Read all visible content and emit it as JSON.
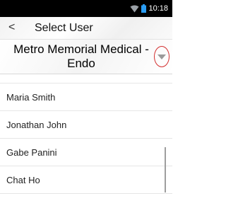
{
  "status_bar": {
    "time": "10:18",
    "icons": [
      "wifi-icon",
      "battery-icon"
    ],
    "battery_color": "#2a9df4"
  },
  "header": {
    "back_label": "<",
    "title": "Select User"
  },
  "facility": {
    "name": "Metro Memorial Medical - Endo",
    "dropdown_icon": "chevron-down-icon",
    "highlight_color": "#d32f2f"
  },
  "users": [
    {
      "name": "Maria Smith"
    },
    {
      "name": "Jonathan John"
    },
    {
      "name": "Gabe Panini"
    },
    {
      "name": "Chat Ho"
    }
  ]
}
